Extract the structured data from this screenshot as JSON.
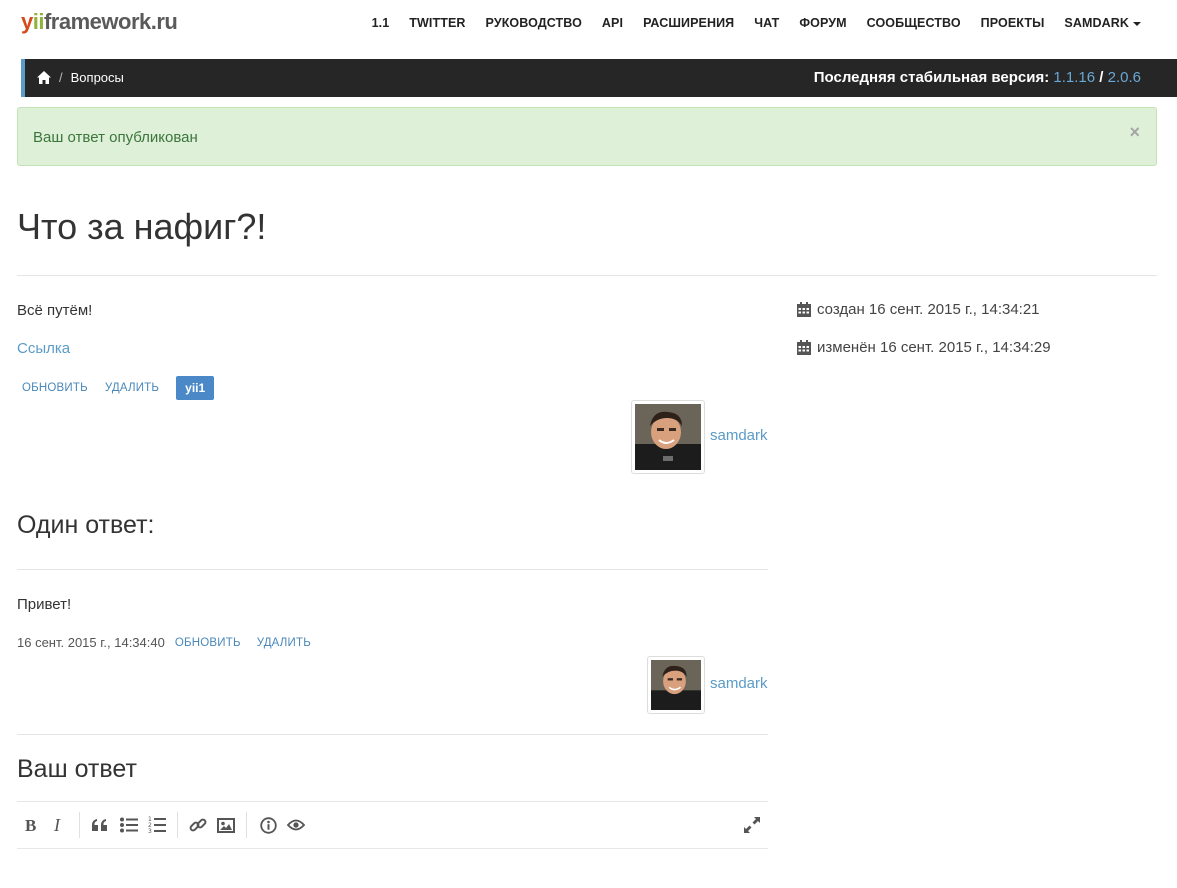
{
  "navbar": {
    "logo": {
      "y": "y",
      "ii": "ii",
      "rest": "framework.ru"
    },
    "items": [
      {
        "label": "1.1"
      },
      {
        "label": "TWITTER"
      },
      {
        "label": "РУКОВОДСТВО"
      },
      {
        "label": "API"
      },
      {
        "label": "РАСШИРЕНИЯ"
      },
      {
        "label": "ЧАТ"
      },
      {
        "label": "ФОРУМ"
      },
      {
        "label": "СООБЩЕСТВО"
      },
      {
        "label": "ПРОЕКТЫ"
      },
      {
        "label": "SAMDARK"
      }
    ]
  },
  "breadcrumb": {
    "separator": "/",
    "current": "Вопросы"
  },
  "version": {
    "label": "Последняя стабильная версия:",
    "v1": "1.1.16",
    "sep": "/",
    "v2": "2.0.6"
  },
  "alert": {
    "text": "Ваш ответ опубликован",
    "close": "×"
  },
  "question": {
    "title": "Что за нафиг?!",
    "text": "Всё путём!",
    "link": "Ссылка",
    "update": "ОБНОВИТЬ",
    "delete": "УДАЛИТЬ",
    "tag": "yii1",
    "author": "samdark",
    "created": "создан 16 сент. 2015 г., 14:34:21",
    "modified": "изменён 16 сент. 2015 г., 14:34:29"
  },
  "answers": {
    "title": "Один ответ:",
    "items": [
      {
        "text": "Привет!",
        "date": "16 сент. 2015 г., 14:34:40",
        "update": "ОБНОВИТЬ",
        "delete": "УДАЛИТЬ",
        "author": "samdark"
      }
    ]
  },
  "your_answer": {
    "title": "Ваш ответ",
    "toolbar": [
      "bold-icon",
      "italic-icon",
      "quote-icon",
      "bullet-list-icon",
      "numbered-list-icon",
      "link-icon",
      "image-icon",
      "info-icon",
      "preview-icon",
      "fullscreen-icon"
    ]
  },
  "colors": {
    "accent": "#5b9bc7",
    "alert_bg": "#dff0d8",
    "alert_text": "#3c763d",
    "bar": "#262626",
    "tag": "#4a88c8"
  }
}
